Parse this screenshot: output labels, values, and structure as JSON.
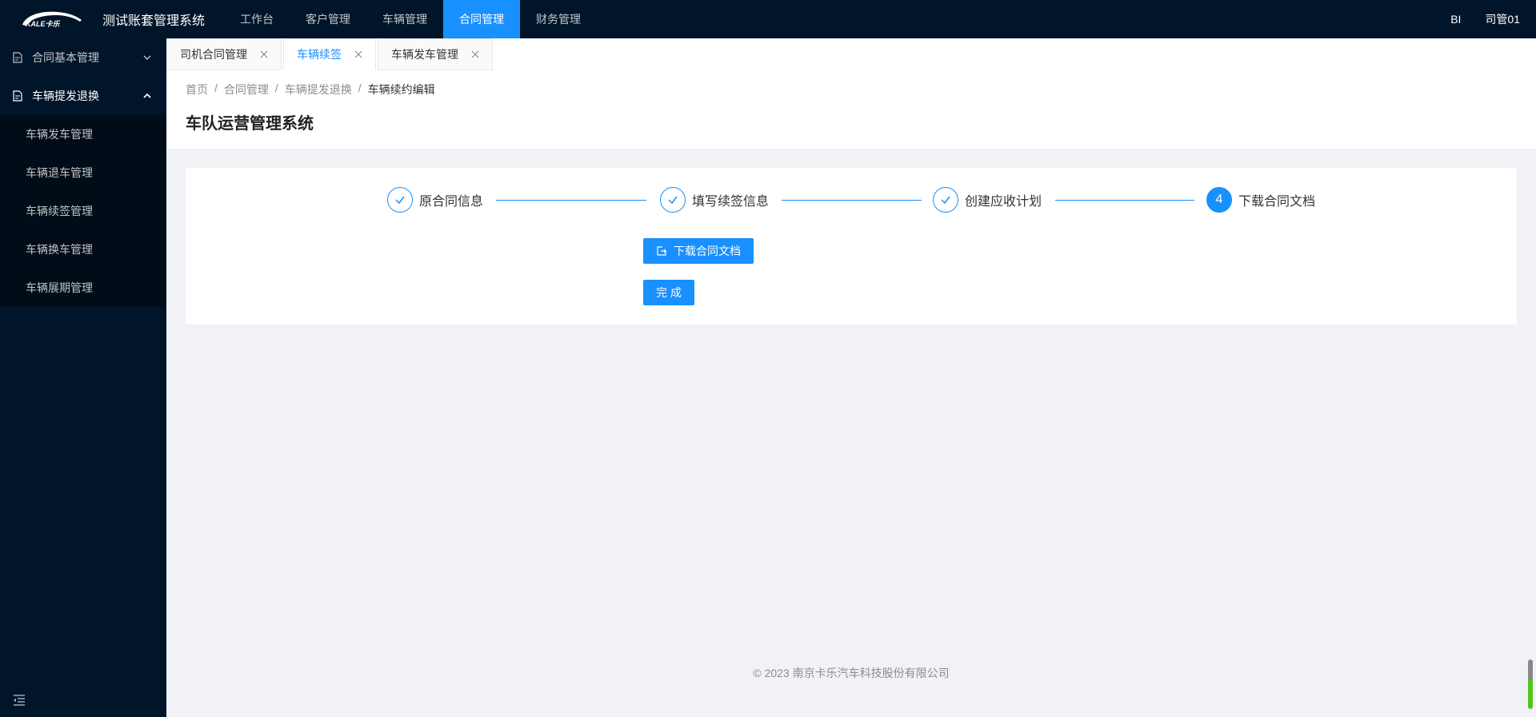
{
  "header": {
    "logo_text": "KALE卡乐",
    "app_title": "测试账套管理系统",
    "nav": [
      {
        "label": "工作台"
      },
      {
        "label": "客户管理"
      },
      {
        "label": "车辆管理"
      },
      {
        "label": "合同管理",
        "active": true
      },
      {
        "label": "财务管理"
      }
    ],
    "bi_label": "BI",
    "user_name": "司管01"
  },
  "sidebar": {
    "groups": [
      {
        "label": "合同基本管理",
        "open": false
      },
      {
        "label": "车辆提发退换",
        "open": true
      }
    ],
    "sub_items": [
      {
        "label": "车辆发车管理"
      },
      {
        "label": "车辆退车管理"
      },
      {
        "label": "车辆续签管理"
      },
      {
        "label": "车辆换车管理"
      },
      {
        "label": "车辆展期管理"
      }
    ]
  },
  "tabs": [
    {
      "label": "司机合同管理"
    },
    {
      "label": "车辆续签",
      "active": true
    },
    {
      "label": "车辆发车管理"
    }
  ],
  "breadcrumb": [
    "首页",
    "合同管理",
    "车辆提发退换",
    "车辆续约编辑"
  ],
  "breadcrumb_sep": "/",
  "page_title": "车队运营管理系统",
  "steps": [
    {
      "label": "原合同信息",
      "status": "finished"
    },
    {
      "label": "填写续签信息",
      "status": "finished"
    },
    {
      "label": "创建应收计划",
      "status": "finished"
    },
    {
      "label": "下载合同文档",
      "status": "active",
      "number": "4"
    }
  ],
  "buttons": {
    "download": "下载合同文档",
    "finish": "完 成"
  },
  "footer": "2023 南京卡乐汽车科技股份有限公司",
  "colors": {
    "primary": "#1890ff",
    "nav_bg": "#001529"
  }
}
